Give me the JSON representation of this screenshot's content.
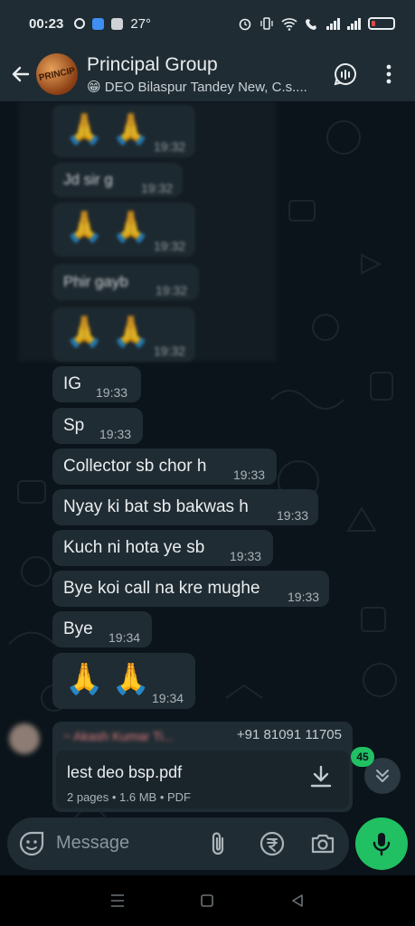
{
  "status": {
    "time": "00:23",
    "temperature": "27°",
    "battery_level": 0.2,
    "battery_color": "#e04848"
  },
  "header": {
    "avatar_text": "PRINCIP",
    "group_name": "Principal Group",
    "members": "😁 DEO Bilaspur Tandey New, C.s....",
    "back_icon": "arrow-left-icon",
    "call_icon": "voice-chat-icon",
    "menu_icon": "more-vert-icon"
  },
  "blurred_messages": [
    {
      "text": "Jd sir g",
      "time": "19:32"
    },
    {
      "text": "Phir gayb",
      "time": "19:32"
    }
  ],
  "blurred_emoji_messages": [
    {
      "emoji": "🙏 🙏",
      "time": "19:32"
    },
    {
      "emoji": "🙏 🙏",
      "time": "19:32"
    },
    {
      "emoji": "🙏 🙏",
      "time": "19:32"
    }
  ],
  "messages": [
    {
      "text": "IG",
      "time": "19:33"
    },
    {
      "text": "Sp",
      "time": "19:33"
    },
    {
      "text": "Collector sb chor h",
      "time": "19:33"
    },
    {
      "text": "Nyay ki bat sb bakwas h",
      "time": "19:33"
    },
    {
      "text": "Kuch ni hota ye sb",
      "time": "19:33"
    },
    {
      "text": "Bye koi call na kre mughe",
      "time": "19:33"
    },
    {
      "text": "Bye",
      "time": "19:34"
    }
  ],
  "emoji_message": {
    "emoji": "🙏 🙏",
    "time": "19:34"
  },
  "document_message": {
    "sender": "~ Akash Kumar Ti...",
    "phone": "+91 81091 11705",
    "file_name": "lest deo bsp.pdf",
    "meta": "2 pages • 1.6 MB • PDF",
    "download_icon": "download-icon"
  },
  "scroll_down": {
    "unread_count": "45",
    "icon": "double-chevron-down-icon"
  },
  "input": {
    "placeholder": "Message",
    "sticker_icon": "sticker-icon",
    "attach_icon": "paperclip-icon",
    "payment_icon": "rupee-icon",
    "camera_icon": "camera-icon",
    "mic_icon": "mic-icon"
  },
  "colors": {
    "app_bar": "#1f2c33",
    "chat_bg": "#0b141a",
    "bubble": "#202c33",
    "accent_green": "#21c063"
  },
  "nav": {
    "recents_icon": "menu-lines-icon",
    "home_icon": "square-icon",
    "back_icon": "triangle-back-icon"
  }
}
